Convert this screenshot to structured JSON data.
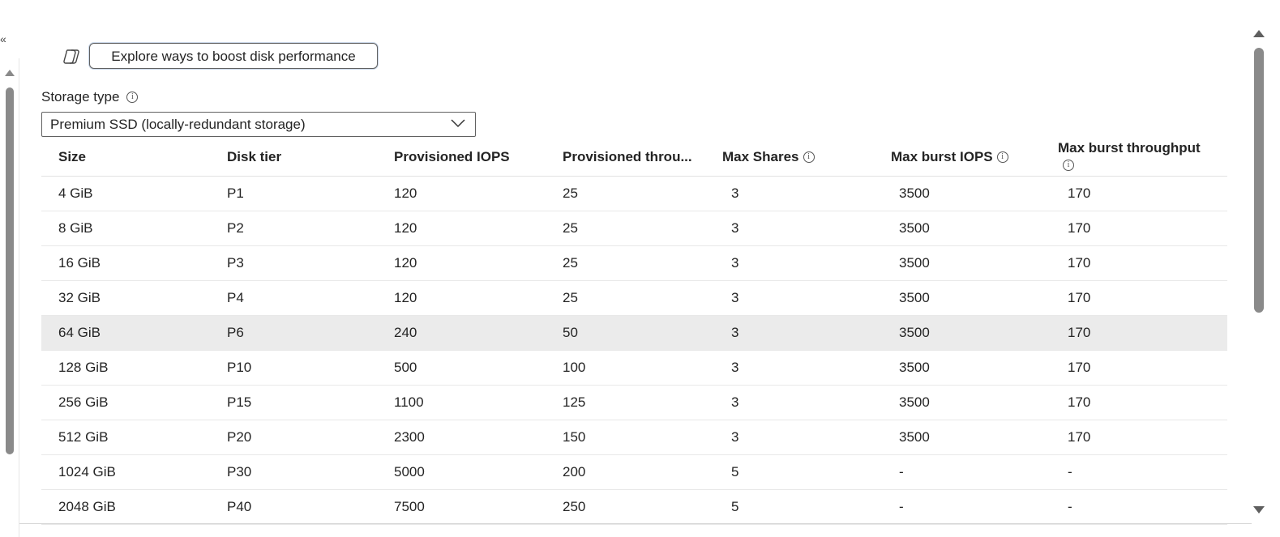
{
  "copilot_button": {
    "label": "Explore ways to boost disk performance",
    "icon": "copilot-icon"
  },
  "storage_type": {
    "label": "Storage type",
    "selected": "Premium SSD (locally-redundant storage)"
  },
  "table": {
    "headers": {
      "size": "Size",
      "disk_tier": "Disk tier",
      "provisioned_iops": "Provisioned IOPS",
      "provisioned_throughput": "Provisioned throu...",
      "max_shares": "Max Shares",
      "max_burst_iops": "Max burst IOPS",
      "max_burst_throughput": "Max burst throughput"
    },
    "rows": [
      {
        "size": "4 GiB",
        "tier": "P1",
        "iops": "120",
        "throughput": "25",
        "shares": "3",
        "burst_iops": "3500",
        "burst_throughput": "170"
      },
      {
        "size": "8 GiB",
        "tier": "P2",
        "iops": "120",
        "throughput": "25",
        "shares": "3",
        "burst_iops": "3500",
        "burst_throughput": "170"
      },
      {
        "size": "16 GiB",
        "tier": "P3",
        "iops": "120",
        "throughput": "25",
        "shares": "3",
        "burst_iops": "3500",
        "burst_throughput": "170"
      },
      {
        "size": "32 GiB",
        "tier": "P4",
        "iops": "120",
        "throughput": "25",
        "shares": "3",
        "burst_iops": "3500",
        "burst_throughput": "170"
      },
      {
        "size": "64 GiB",
        "tier": "P6",
        "iops": "240",
        "throughput": "50",
        "shares": "3",
        "burst_iops": "3500",
        "burst_throughput": "170"
      },
      {
        "size": "128 GiB",
        "tier": "P10",
        "iops": "500",
        "throughput": "100",
        "shares": "3",
        "burst_iops": "3500",
        "burst_throughput": "170"
      },
      {
        "size": "256 GiB",
        "tier": "P15",
        "iops": "1100",
        "throughput": "125",
        "shares": "3",
        "burst_iops": "3500",
        "burst_throughput": "170"
      },
      {
        "size": "512 GiB",
        "tier": "P20",
        "iops": "2300",
        "throughput": "150",
        "shares": "3",
        "burst_iops": "3500",
        "burst_throughput": "170"
      },
      {
        "size": "1024 GiB",
        "tier": "P30",
        "iops": "5000",
        "throughput": "200",
        "shares": "5",
        "burst_iops": "-",
        "burst_throughput": "-"
      },
      {
        "size": "2048 GiB",
        "tier": "P40",
        "iops": "7500",
        "throughput": "250",
        "shares": "5",
        "burst_iops": "-",
        "burst_throughput": "-"
      }
    ],
    "selected_row_index": 4
  },
  "icons": {
    "collapse": "chevron-double-left-icon",
    "info": "info-icon",
    "dropdown": "chevron-down-icon"
  }
}
